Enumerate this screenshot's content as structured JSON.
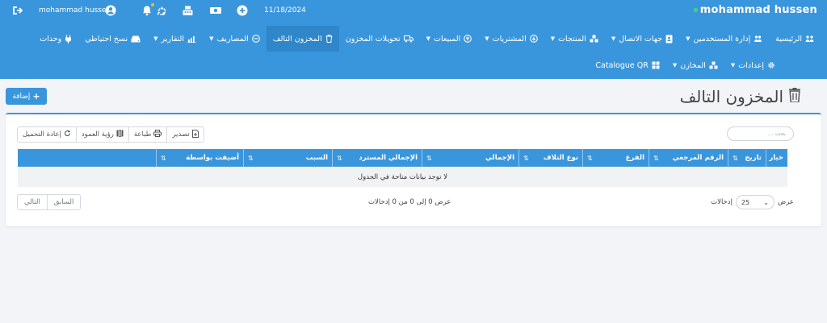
{
  "topbar": {
    "brand": "mohammad hussen",
    "date": "11/18/2024",
    "username": "mohammad hussen",
    "icons": [
      "logout-icon",
      "user-icon",
      "bell-icon",
      "recycle-icon",
      "cash-register-icon",
      "money-icon",
      "plus-circle-icon"
    ]
  },
  "nav": {
    "row1": [
      {
        "label": "الرئيسية",
        "icon": "home-icon",
        "dropdown": false
      },
      {
        "label": "إدارة المستخدمين",
        "icon": "users-icon",
        "dropdown": true
      },
      {
        "label": "جهات الاتصال",
        "icon": "contacts-icon",
        "dropdown": true
      },
      {
        "label": "المنتجات",
        "icon": "cubes-icon",
        "dropdown": true
      },
      {
        "label": "المشتريات",
        "icon": "download-circle-icon",
        "dropdown": true
      },
      {
        "label": "المبيعات",
        "icon": "upload-circle-icon",
        "dropdown": true
      },
      {
        "label": "تحويلات المخزون",
        "icon": "truck-icon",
        "dropdown": false
      },
      {
        "label": "المخزون التالف",
        "icon": "trash-icon",
        "dropdown": false,
        "active": true
      },
      {
        "label": "المصاريف",
        "icon": "minus-circle-icon",
        "dropdown": true
      },
      {
        "label": "التقارير",
        "icon": "bar-chart-icon",
        "dropdown": true
      },
      {
        "label": "نسخ احتياطي",
        "icon": "hdd-icon",
        "dropdown": false
      },
      {
        "label": "وحدات",
        "icon": "plug-icon",
        "dropdown": false
      }
    ],
    "row2": [
      {
        "label": "إعدادات",
        "icon": "gear-icon",
        "dropdown": true
      },
      {
        "label": "المخازن",
        "icon": "cubes-icon",
        "dropdown": true
      },
      {
        "label": "Catalogue QR",
        "icon": "grid-icon",
        "dropdown": false
      }
    ]
  },
  "page": {
    "title": "المخزون التالف",
    "add_button": "إضافة"
  },
  "table": {
    "search_placeholder": "بحث ...",
    "toolbar": [
      "تصدير",
      "طباعة",
      "رؤية العمود",
      "إعادة التحميل"
    ],
    "columns": [
      "خيار",
      "تاريخ",
      "الرقم المرجعي",
      "الفرع",
      "نوع التلاف",
      "الإجمالي",
      "الإجمالي المسترد",
      "السبب",
      "أضيفت بواسطة"
    ],
    "empty_message": "لا توجد بيانات متاحة في الجدول",
    "show_label": "عرض",
    "entries_value": "25",
    "entries_label": "إدخالات",
    "info": "عرض 0 إلى 0 من 0 إدخالات",
    "prev_label": "السابق",
    "next_label": "التالي"
  },
  "colors": {
    "primary": "#3a96dc",
    "active_nav": "#2f86c8",
    "background": "#f3f4f7"
  }
}
